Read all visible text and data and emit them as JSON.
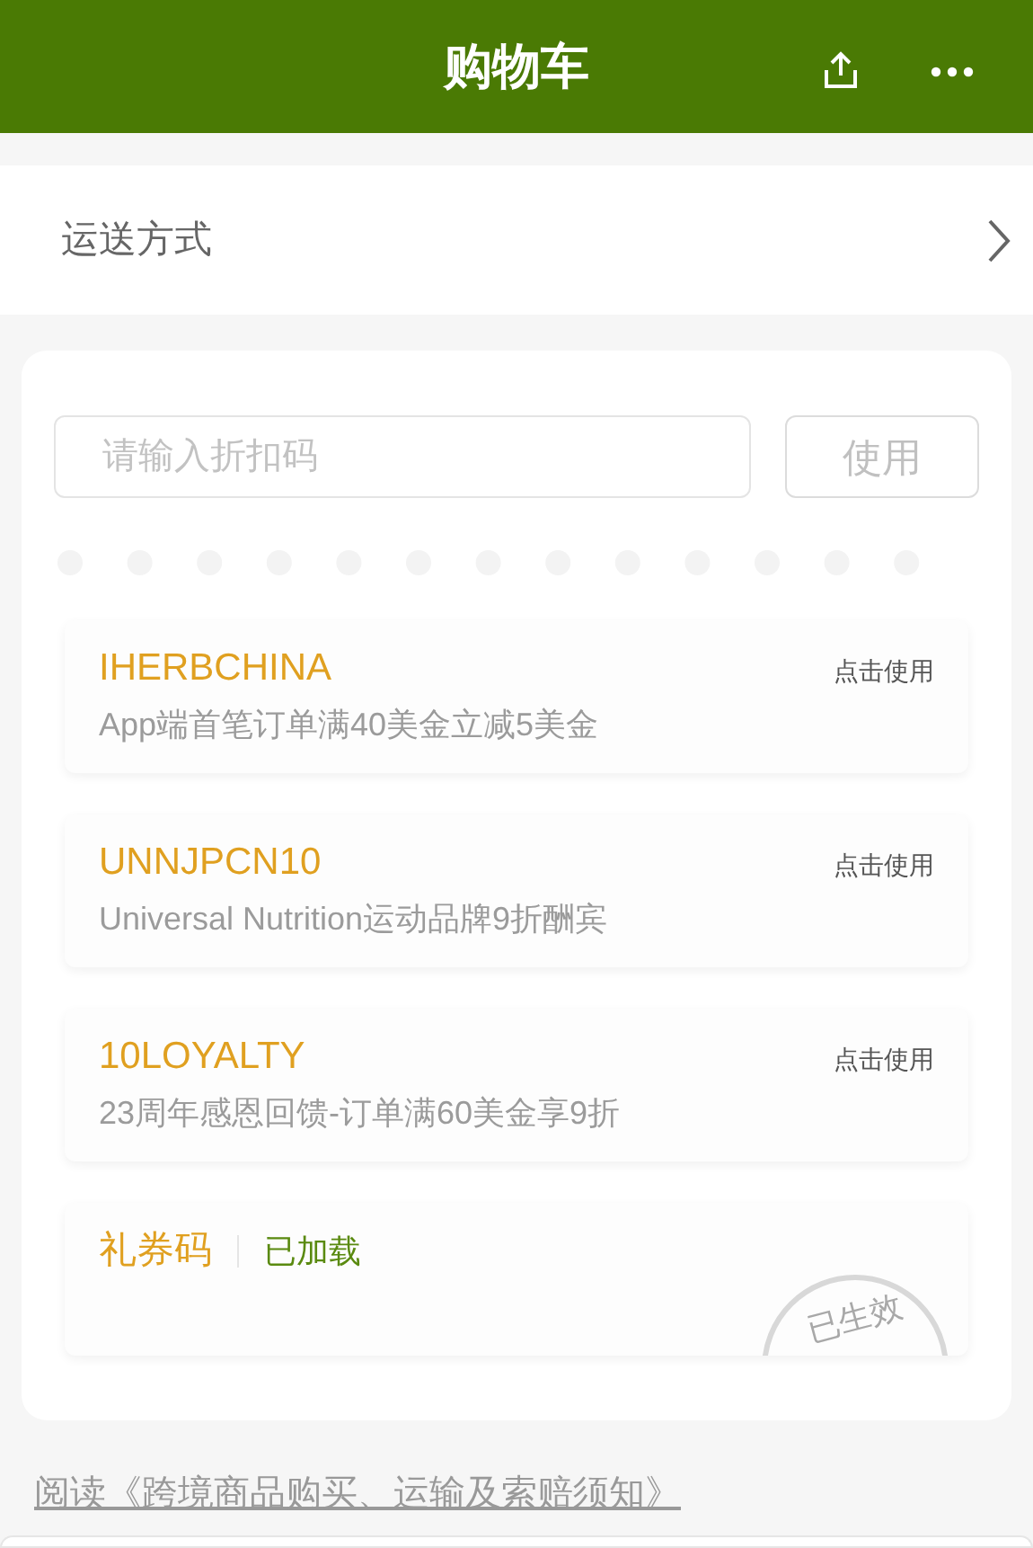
{
  "header": {
    "title": "购物车"
  },
  "shipping": {
    "label": "运送方式"
  },
  "promo": {
    "placeholder": "请输入折扣码",
    "button": "使用"
  },
  "coupons": [
    {
      "kind": "coupon",
      "code": "IHERBCHINA",
      "description": "App端首笔订单满40美金立减5美金",
      "action": "点击使用"
    },
    {
      "kind": "coupon",
      "code": "UNNJPCN10",
      "description": "Universal Nutrition运动品牌9折酬宾",
      "action": "点击使用"
    },
    {
      "kind": "coupon",
      "code": "10LOYALTY",
      "description": "23周年感恩回馈-订单满60美金享9折",
      "action": "点击使用"
    },
    {
      "kind": "gift",
      "code": "礼券码",
      "status": "已加载",
      "stamp": "已生效"
    }
  ],
  "notice_link": "阅读《跨境商品购买、运输及索赔须知》"
}
